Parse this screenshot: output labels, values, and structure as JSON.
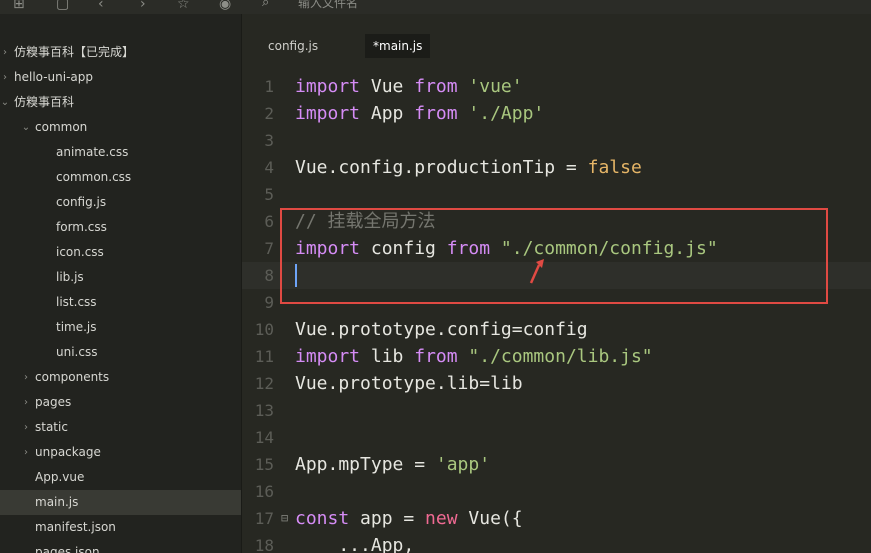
{
  "search": {
    "placeholder": "输入文件名"
  },
  "tabs": [
    {
      "label": "config.js",
      "active": false
    },
    {
      "label": "*main.js",
      "active": true
    }
  ],
  "sidebar": {
    "items": [
      {
        "label": "仿糗事百科【已完成】",
        "expander": "right"
      },
      {
        "label": "hello-uni-app",
        "expander": "right"
      },
      {
        "label": "仿糗事百科",
        "expander": "down"
      },
      {
        "label": "common",
        "expander": "down"
      },
      {
        "label": "animate.css"
      },
      {
        "label": "common.css"
      },
      {
        "label": "config.js"
      },
      {
        "label": "form.css"
      },
      {
        "label": "icon.css"
      },
      {
        "label": "lib.js"
      },
      {
        "label": "list.css"
      },
      {
        "label": "time.js"
      },
      {
        "label": "uni.css"
      },
      {
        "label": "components",
        "expander": "right"
      },
      {
        "label": "pages",
        "expander": "right"
      },
      {
        "label": "static",
        "expander": "right"
      },
      {
        "label": "unpackage",
        "expander": "right"
      },
      {
        "label": "App.vue"
      },
      {
        "label": "main.js",
        "selected": true
      },
      {
        "label": "manifest.json"
      },
      {
        "label": "pages.json"
      }
    ]
  },
  "code": {
    "lines": [
      {
        "n": "1",
        "tokens": [
          [
            "kw",
            "import"
          ],
          [
            "",
            "Vue"
          ],
          [
            "kw",
            "from"
          ],
          [
            "str",
            "'vue'"
          ]
        ]
      },
      {
        "n": "2",
        "tokens": [
          [
            "kw",
            "import"
          ],
          [
            "",
            "App"
          ],
          [
            "kw",
            "from"
          ],
          [
            "str",
            "'./App'"
          ]
        ]
      },
      {
        "n": "3",
        "tokens": []
      },
      {
        "n": "4",
        "tokens": [
          [
            "",
            "Vue.config.productionTip ="
          ],
          [
            "cons",
            "false"
          ]
        ]
      },
      {
        "n": "5",
        "tokens": []
      },
      {
        "n": "6",
        "tokens": [
          [
            "cm",
            "// 挂载全局方法"
          ]
        ]
      },
      {
        "n": "7",
        "tokens": [
          [
            "kw",
            "import"
          ],
          [
            "",
            "config"
          ],
          [
            "kw",
            "from"
          ],
          [
            "str",
            "\"./common/config.js\""
          ]
        ]
      },
      {
        "n": "8",
        "tokens": [],
        "current": true
      },
      {
        "n": "9",
        "tokens": []
      },
      {
        "n": "10",
        "tokens": [
          [
            "",
            "Vue.prototype.config=config"
          ]
        ]
      },
      {
        "n": "11",
        "tokens": [
          [
            "kw",
            "import"
          ],
          [
            "",
            "lib"
          ],
          [
            "kw",
            "from"
          ],
          [
            "str",
            "\"./common/lib.js\""
          ]
        ]
      },
      {
        "n": "12",
        "tokens": [
          [
            "",
            "Vue.prototype.lib=lib"
          ]
        ]
      },
      {
        "n": "13",
        "tokens": []
      },
      {
        "n": "14",
        "tokens": []
      },
      {
        "n": "15",
        "tokens": [
          [
            "",
            "App.mpType ="
          ],
          [
            "str",
            "'app'"
          ]
        ]
      },
      {
        "n": "16",
        "tokens": []
      },
      {
        "n": "17",
        "tokens": [
          [
            "kw",
            "const"
          ],
          [
            "",
            "app ="
          ],
          [
            "kw2",
            "new"
          ],
          [
            "",
            "Vue({"
          ]
        ],
        "fold": true
      },
      {
        "n": "18",
        "tokens": [
          [
            "",
            "    ...App,"
          ]
        ]
      }
    ]
  },
  "colors": {
    "background": "#272822",
    "keyword": "#d58cf5",
    "string": "#a9c77f",
    "comment": "#75766f",
    "highlight_box": "#e04a43"
  }
}
